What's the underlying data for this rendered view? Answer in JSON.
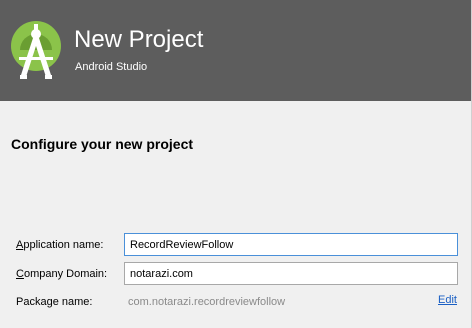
{
  "header": {
    "title": "New Project",
    "subtitle": "Android Studio",
    "logo_icon": "android-studio-logo-icon",
    "background_color": "#5d5d5d",
    "logo_color": "#8bc34a"
  },
  "main": {
    "heading": "Configure your new project",
    "fields": {
      "application_name": {
        "label_mnemonic": "A",
        "label_rest": "pplication name:",
        "value": "RecordReviewFollow"
      },
      "company_domain": {
        "label_mnemonic": "C",
        "label_rest": "ompany Domain:",
        "value": "notarazi.com"
      },
      "package_name": {
        "label": "Package name:",
        "value": "com.notarazi.recordreviewfollow",
        "edit_label": "Edit"
      }
    }
  }
}
